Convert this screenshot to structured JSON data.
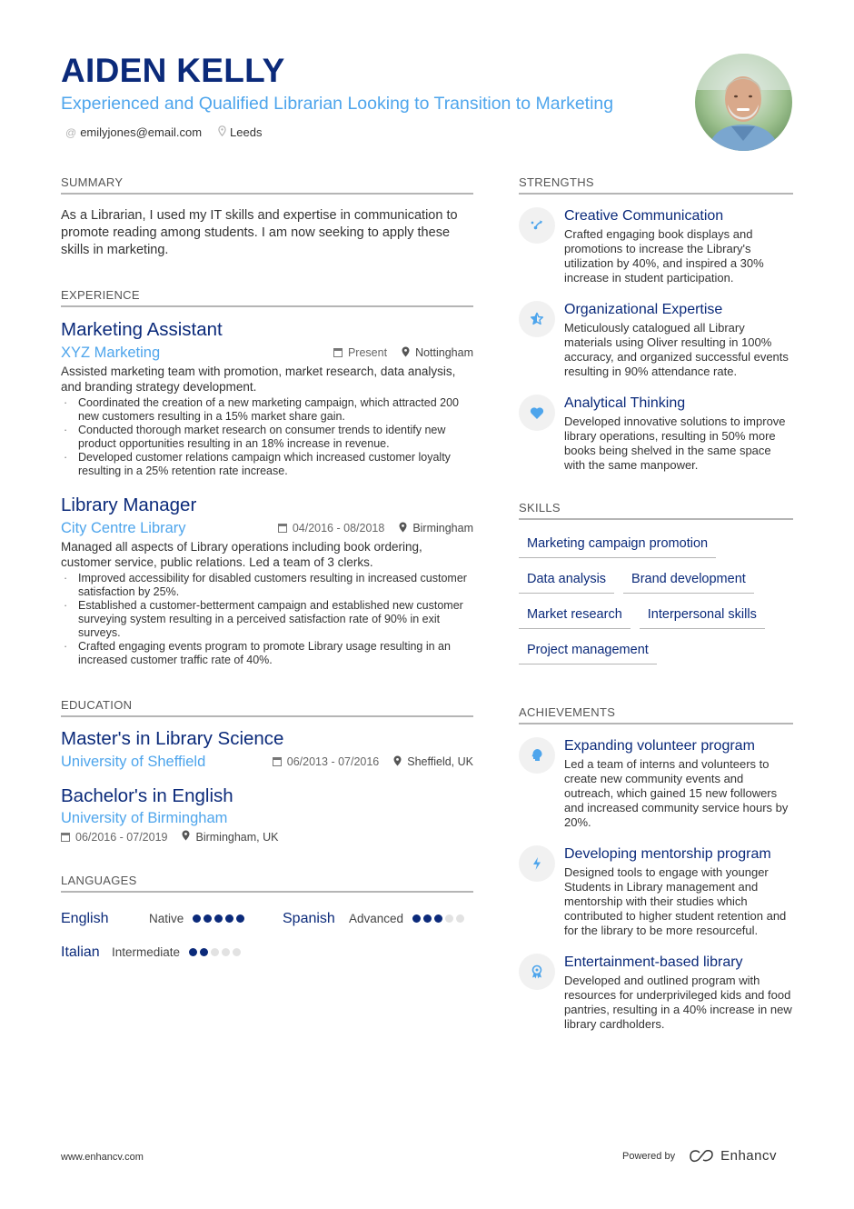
{
  "header": {
    "name": "AIDEN KELLY",
    "headline": "Experienced and Qualified Librarian Looking to Transition to Marketing",
    "email": "emilyjones@email.com",
    "location": "Leeds",
    "email_icon": "at-icon",
    "location_icon": "map-pin-icon",
    "photo_alt": "profile-photo"
  },
  "summary": {
    "title": "SUMMARY",
    "text": "As a Librarian, I used my IT skills and expertise in communication to promote reading among students. I am now seeking to apply these skills in marketing."
  },
  "experience": {
    "title": "EXPERIENCE",
    "items": [
      {
        "role": "Marketing Assistant",
        "company": "XYZ Marketing",
        "dates": "Present",
        "location": "Nottingham",
        "description": "Assisted marketing team with promotion, market research, data analysis, and branding strategy development.",
        "bullets": [
          "Coordinated the creation of a new marketing campaign, which attracted 200 new customers resulting in a 15% market share gain.",
          "Conducted thorough market research on consumer trends to identify new product opportunities resulting in an 18% increase in revenue.",
          "Developed customer relations campaign which increased customer loyalty resulting in a 25% retention rate increase."
        ]
      },
      {
        "role": "Library Manager",
        "company": "City Centre Library",
        "dates": "04/2016 - 08/2018",
        "location": "Birmingham",
        "description": "Managed all aspects of Library operations including book ordering, customer service, public relations. Led a team of 3 clerks.",
        "bullets": [
          "Improved accessibility for disabled customers resulting in increased customer satisfaction by 25%.",
          "Established a customer-betterment campaign and established new customer surveying system resulting in a perceived satisfaction rate of 90% in exit surveys.",
          "Crafted engaging events program to promote Library usage resulting in an increased customer traffic rate of 40%."
        ]
      }
    ]
  },
  "education": {
    "title": "EDUCATION",
    "items": [
      {
        "degree": "Master's in Library Science",
        "school": "University of Sheffield",
        "dates": "06/2013 - 07/2016",
        "location": "Sheffield, UK"
      },
      {
        "degree": "Bachelor's in English",
        "school": "University of Birmingham",
        "dates": "06/2016 - 07/2019",
        "location": "Birmingham, UK"
      }
    ]
  },
  "languages": {
    "title": "LANGUAGES",
    "items": [
      {
        "name": "English",
        "level": "Native",
        "rating": 5,
        "max": 5
      },
      {
        "name": "Spanish",
        "level": "Advanced",
        "rating": 3,
        "max": 5
      },
      {
        "name": "Italian",
        "level": "Intermediate",
        "rating": 2,
        "max": 5
      }
    ]
  },
  "strengths": {
    "title": "STRENGTHS",
    "items": [
      {
        "icon": "magic-wand-icon",
        "title": "Creative Communication",
        "description": "Crafted engaging book displays and promotions to increase the Library's utilization by 40%, and inspired a 30% increase in student participation."
      },
      {
        "icon": "star-icon",
        "title": "Organizational Expertise",
        "description": "Meticulously catalogued all Library materials using Oliver resulting in 100% accuracy, and organized successful events resulting in 90% attendance rate."
      },
      {
        "icon": "heart-icon",
        "title": "Analytical Thinking",
        "description": "Developed innovative solutions to improve library operations, resulting in 50% more books being shelved in the same space with the same manpower."
      }
    ]
  },
  "skills": {
    "title": "SKILLS",
    "items": [
      "Marketing campaign promotion",
      "Data analysis",
      "Brand development",
      "Market research",
      "Interpersonal skills",
      "Project management"
    ]
  },
  "achievements": {
    "title": "ACHIEVEMENTS",
    "items": [
      {
        "icon": "head-idea-icon",
        "title": "Expanding volunteer program",
        "description": "Led a team of interns and volunteers to create new community events and outreach, which gained 15 new followers and increased community service hours by 20%."
      },
      {
        "icon": "lightning-icon",
        "title": "Developing mentorship program",
        "description": "Designed tools to engage with younger Students in Library management and mentorship with their studies which contributed to higher student retention and for the library to be more resourceful."
      },
      {
        "icon": "award-icon",
        "title": "Entertainment-based library",
        "description": "Developed and outlined program with resources for underprivileged kids and food pantries, resulting in a 40% increase in new library cardholders."
      }
    ]
  },
  "footer": {
    "website": "www.enhancv.com",
    "powered_by": "Powered by",
    "brand": "Enhancv"
  },
  "colors": {
    "primary": "#0b2a7a",
    "accent": "#4ea5ec",
    "rule": "#b5b5b5",
    "dot_off": "#e2e2e2"
  }
}
